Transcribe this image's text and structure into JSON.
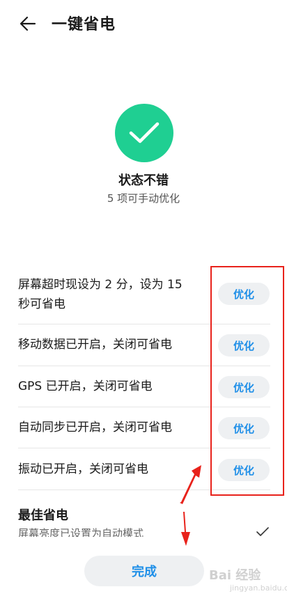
{
  "header": {
    "title": "一键省电"
  },
  "status": {
    "title": "状态不错",
    "subtitle": "5 项可手动优化"
  },
  "items": [
    {
      "line1": "屏幕超时现设为 2 分，设为 15",
      "line2": "秒可省电",
      "button": "优化"
    },
    {
      "line1": "移动数据已开启，关闭可省电",
      "button": "优化"
    },
    {
      "line1": "GPS 已开启，关闭可省电",
      "button": "优化"
    },
    {
      "line1": "自动同步已开启，关闭可省电",
      "button": "优化"
    },
    {
      "line1": "振动已开启，关闭可省电",
      "button": "优化"
    }
  ],
  "best": {
    "title": "最佳省电",
    "subtitle": "屏幕亮度已设置为自动模式"
  },
  "done_label": "完成",
  "watermark": {
    "main": "Bai 经验",
    "sub": "jingyan.baidu.com"
  },
  "colors": {
    "accent": "#1f8fe8",
    "success": "#1fcf92",
    "annotation": "#e8221b"
  }
}
